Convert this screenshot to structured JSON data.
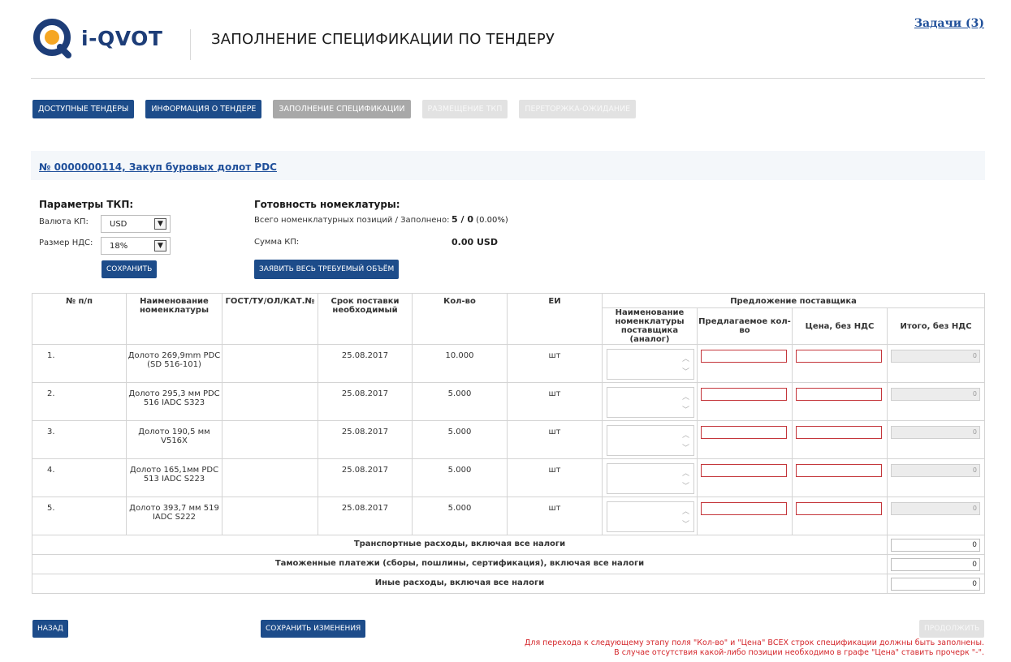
{
  "header": {
    "logo_text": "i-QVOT",
    "page_title": "ЗАПОЛНЕНИЕ СПЕЦИФИКАЦИИ ПО ТЕНДЕРУ",
    "tasks_link": "Задачи (3)"
  },
  "nav": {
    "tabs": [
      {
        "label": "ДОСТУПНЫЕ ТЕНДЕРЫ",
        "state": "active"
      },
      {
        "label": "ИНФОРМАЦИЯ О ТЕНДЕРЕ",
        "state": "active"
      },
      {
        "label": "ЗАПОЛНЕНИЕ СПЕЦИФИКАЦИИ",
        "state": "current"
      },
      {
        "label": "РАЗМЕЩЕНИЕ ТКП",
        "state": "disabled"
      },
      {
        "label": "ПЕРЕТОРЖКА-ОЖИДАНИЕ",
        "state": "disabled"
      }
    ]
  },
  "tender": {
    "link": "№ 0000000114, Закуп буровых долот PDC"
  },
  "params": {
    "title": "Параметры ТКП:",
    "currency_label": "Валюта КП:",
    "currency_value": "USD",
    "vat_label": "Размер НДС:",
    "vat_value": "18%",
    "save_label": "СОХРАНИТЬ"
  },
  "readiness": {
    "title": "Готовность номеклатуры:",
    "positions_label": "Всего номенклатурных позиций / Заполнено:",
    "positions_total": "5",
    "positions_sep": " / ",
    "positions_filled": "0",
    "positions_pct": " (0.00%)",
    "sum_label": "Сумма КП:",
    "sum_value": "0.00 USD",
    "declare_label": "ЗАЯВИТЬ ВЕСЬ ТРЕБУЕМЫЙ ОБЪЁМ"
  },
  "table": {
    "headers": {
      "num": "№ п/п",
      "name": "Наименование номенклатуры",
      "gost": "ГОСТ/ТУ/ОЛ/КАТ.№",
      "date": "Срок поставки необходимый",
      "qty": "Кол-во",
      "unit": "ЕИ",
      "supplier_group": "Предложение поставщика",
      "supplier_name": "Наименование номенклатуры поставщика (аналог)",
      "offered_qty": "Предлагаемое кол-во",
      "price": "Цена, без НДС",
      "total": "Итого, без НДС"
    },
    "rows": [
      {
        "num": "1.",
        "name": "Долото 269,9mm PDC (SD 516-101)",
        "date": "25.08.2017",
        "qty": "10.000",
        "unit": "шт",
        "total": "0"
      },
      {
        "num": "2.",
        "name": "Долото 295,3 мм PDC 516 IADC S323",
        "date": "25.08.2017",
        "qty": "5.000",
        "unit": "шт",
        "total": "0"
      },
      {
        "num": "3.",
        "name": "Долото 190,5 мм V516X",
        "date": "25.08.2017",
        "qty": "5.000",
        "unit": "шт",
        "total": "0"
      },
      {
        "num": "4.",
        "name": "Долото 165,1мм PDC 513 IADC S223",
        "date": "25.08.2017",
        "qty": "5.000",
        "unit": "шт",
        "total": "0"
      },
      {
        "num": "5.",
        "name": "Долото 393,7 мм 519 IADC S222",
        "date": "25.08.2017",
        "qty": "5.000",
        "unit": "шт",
        "total": "0"
      }
    ],
    "summary": [
      {
        "label": "Транспортные расходы, включая все налоги",
        "value": "0"
      },
      {
        "label": "Таможенные платежи (сборы, пошлины, сертификация), включая все налоги",
        "value": "0"
      },
      {
        "label": "Иные расходы, включая все налоги",
        "value": "0"
      }
    ]
  },
  "footer": {
    "back_label": "НАЗАД",
    "save_changes_label": "СОХРАНИТЬ ИЗМЕНЕНИЯ",
    "next_label": "ПРОДОЛЖИТЬ",
    "note_line1": "Для перехода к следующему этапу поля \"Кол-во\" и \"Цена\" ВСЕХ строк спецификации должны быть заполнены.",
    "note_line2": "В случае отсутствия какой-либо позиции необходимо в графе \"Цена\" ставить прочерк \"-\"."
  },
  "colors": {
    "brand_blue": "#1d4c8a",
    "link_blue": "#1f4f9a",
    "logo_orange": "#f5a623",
    "error_red": "#d4262b"
  }
}
